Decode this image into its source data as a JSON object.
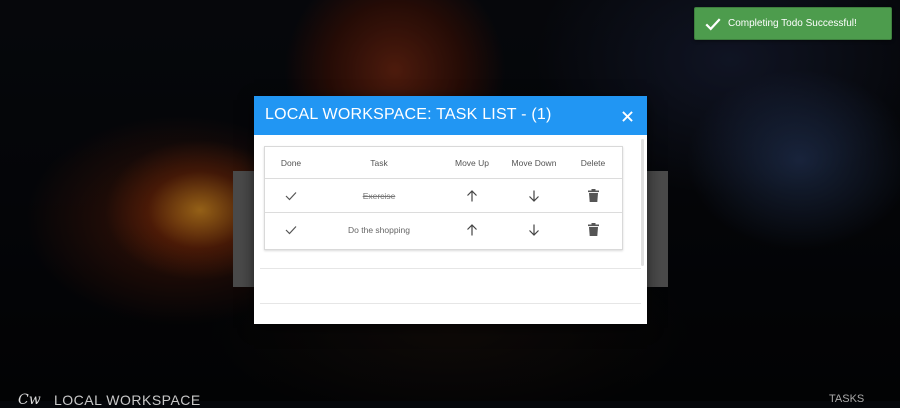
{
  "toast": {
    "message": "Completing Todo Successful!",
    "color": "#4d9c4d",
    "icon": "checkmark-icon"
  },
  "modal": {
    "title": "LOCAL WORKSPACE: TASK LIST - (1)",
    "header_color": "#2196f3",
    "close_icon": "close-icon"
  },
  "table": {
    "headers": {
      "done": "Done",
      "task": "Task",
      "move_up": "Move Up",
      "move_down": "Move Down",
      "delete": "Delete"
    },
    "rows": [
      {
        "task": "Exercise",
        "completed": true
      },
      {
        "task": "Do the shopping",
        "completed": false
      }
    ]
  },
  "appbar": {
    "logo": "Cw",
    "title": "LOCAL WORKSPACE",
    "tasks_link": "TASKS"
  }
}
